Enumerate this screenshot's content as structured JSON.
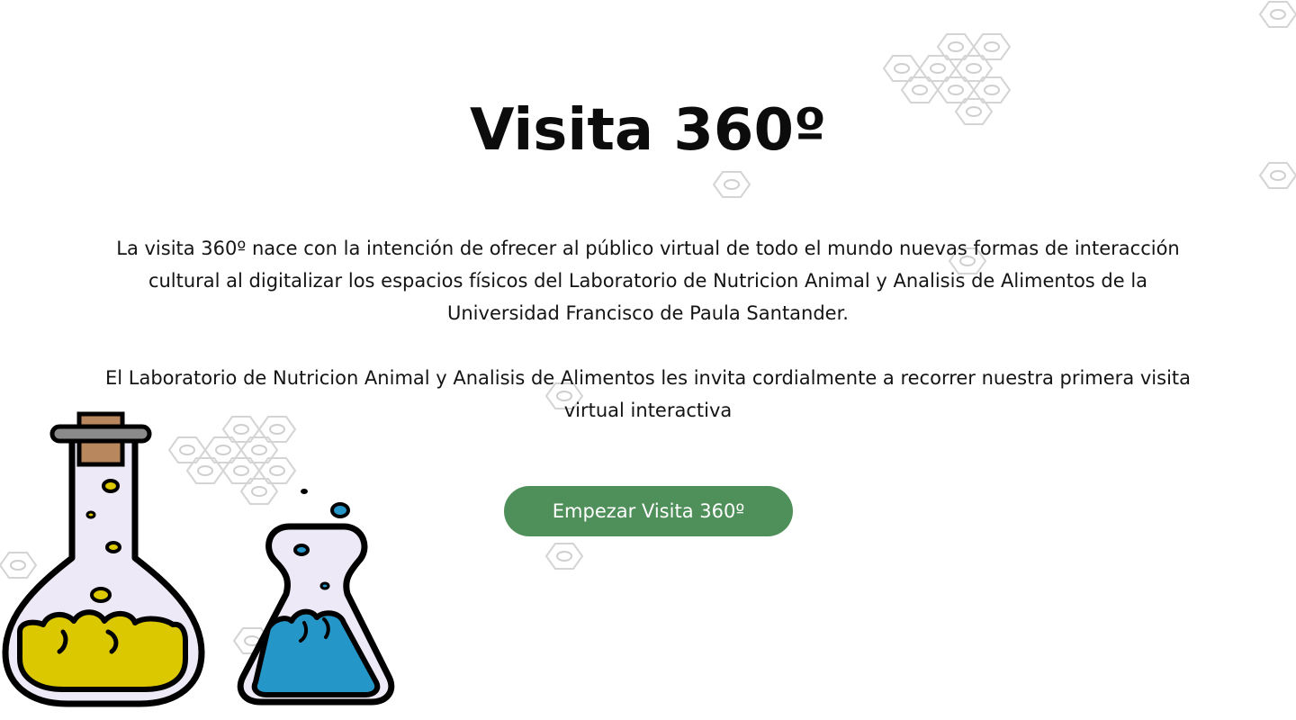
{
  "hero": {
    "title": "Visita 360º",
    "paragraph_1": "La visita 360º nace con la intención de ofrecer al público virtual de todo el mundo nuevas formas de interacción cultural al digitalizar los espacios físicos del Laboratorio de Nutricion Animal y Analisis de Alimentos de la Universidad Francisco de Paula Santander.",
    "paragraph_2": "El Laboratorio de Nutricion Animal y Analisis de Alimentos les invita cordialmente a recorrer nuestra primera visita virtual interactiva",
    "button_label": "Empezar Visita 360º"
  },
  "colors": {
    "accent_button": "#4f8f59",
    "liquid_yellow": "#dcc800",
    "liquid_blue": "#2596c8",
    "glass": "#ede9f6",
    "cork": "#b9875e",
    "hex_pattern": "#d4d4d4"
  },
  "illustration": {
    "name": "laboratory-flasks-icon"
  }
}
